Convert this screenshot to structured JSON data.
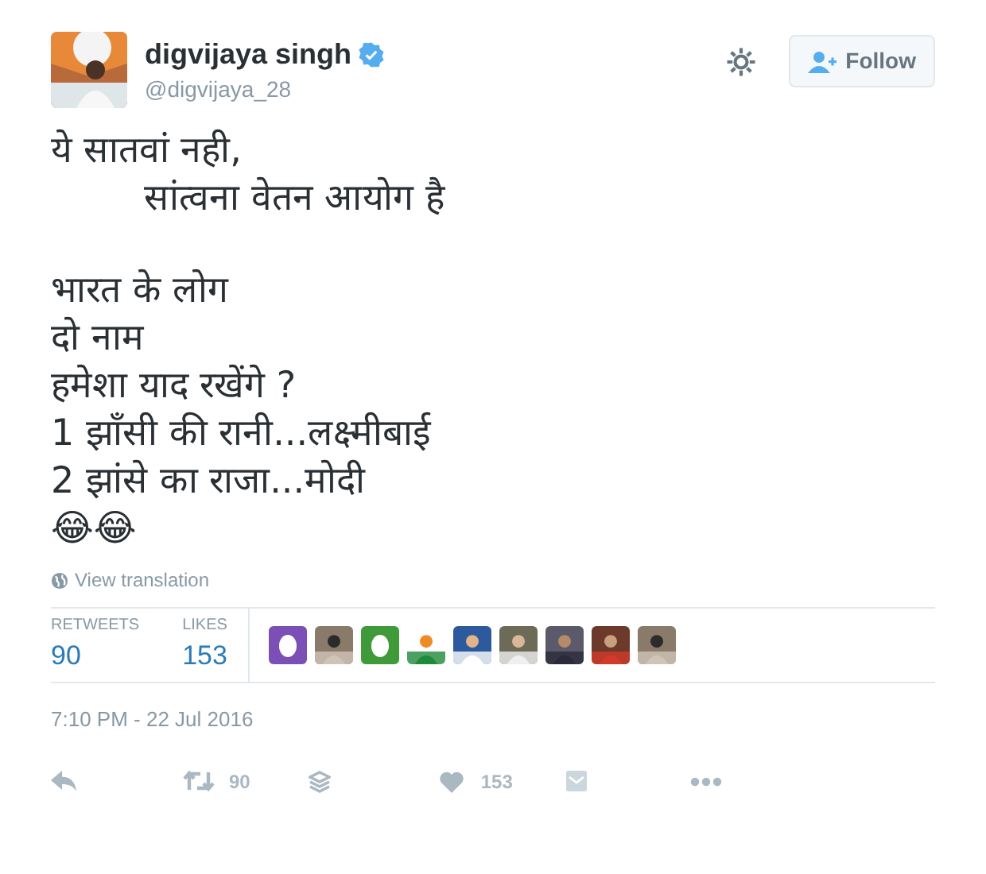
{
  "user": {
    "name": "digvijaya singh",
    "verified": true,
    "handle": "@digvijaya_28"
  },
  "follow_button": {
    "label": "Follow"
  },
  "tweet": {
    "paragraphs": [
      [
        "ये सातवां नही,",
        "        सांत्वना वेतन आयोग है"
      ],
      [
        "भारत के लोग",
        "दो नाम",
        "हमेशा याद रखेंगे ?",
        "1 झाँसी की रानी...लक्ष्मीबाई",
        "2 झांसे का राजा...मोदी",
        "😂😂"
      ]
    ]
  },
  "view_translation": "View translation",
  "stats": [
    {
      "label": "RETWEETS",
      "value": "90"
    },
    {
      "label": "LIKES",
      "value": "153"
    }
  ],
  "likers": [
    {
      "kind": "egg",
      "color": "#7b4fb5"
    },
    {
      "kind": "picture"
    },
    {
      "kind": "egg",
      "color": "#3f9a3a"
    },
    {
      "kind": "picture"
    },
    {
      "kind": "picture"
    },
    {
      "kind": "picture"
    },
    {
      "kind": "picture"
    },
    {
      "kind": "picture"
    },
    {
      "kind": "picture"
    }
  ],
  "timestamp": "7:10 PM - 22 Jul 2016",
  "actions": {
    "retweet_count": "90",
    "like_count": "153"
  }
}
